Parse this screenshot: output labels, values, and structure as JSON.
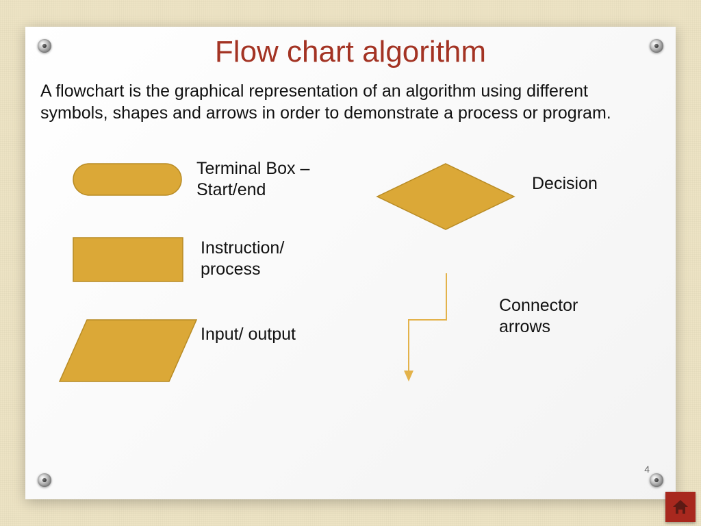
{
  "title": "Flow chart algorithm",
  "description": " A flowchart is the graphical representation of an algorithm using different symbols, shapes and arrows in order to demonstrate a process or program.",
  "symbols": {
    "terminal": "Terminal Box – Start/end",
    "instruction": "Instruction/ process",
    "io": "Input/ output",
    "decision": "Decision",
    "connector": "Connector arrows"
  },
  "page_number": "4",
  "colors": {
    "shape_fill": "#dba837",
    "shape_stroke": "#b88b24",
    "title": "#a33323"
  }
}
